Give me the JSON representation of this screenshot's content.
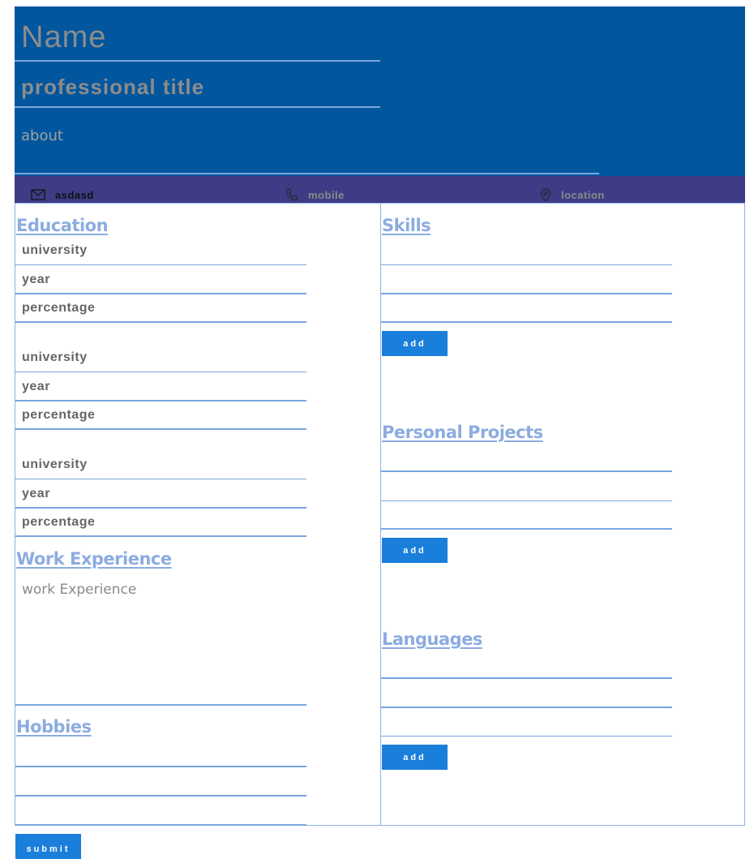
{
  "header": {
    "name_placeholder": "Name",
    "title_placeholder": "professional title",
    "about_placeholder": "about",
    "background": "#02569e"
  },
  "contact": {
    "email_value": "asdasd",
    "email_icon": "envelope-icon",
    "mobile_placeholder": "mobile",
    "mobile_icon": "phone-icon",
    "location_placeholder": "location",
    "location_icon": "map-pin-icon",
    "background": "#3d3c85"
  },
  "education": {
    "title": "Education",
    "entries": [
      {
        "university_placeholder": "university",
        "year_placeholder": "year",
        "percentage_placeholder": "percentage"
      },
      {
        "university_placeholder": "university",
        "year_placeholder": "year",
        "percentage_placeholder": "percentage"
      },
      {
        "university_placeholder": "university",
        "year_placeholder": "year",
        "percentage_placeholder": "percentage"
      }
    ]
  },
  "work": {
    "title": "Work Experience",
    "placeholder": "work Experience"
  },
  "hobbies": {
    "title": "Hobbies",
    "fields": [
      "",
      "",
      ""
    ]
  },
  "skills": {
    "title": "Skills",
    "fields": [
      "",
      "",
      ""
    ],
    "add_label": "add"
  },
  "projects": {
    "title": "Personal Projects",
    "fields": [
      "",
      "",
      ""
    ],
    "add_label": "add"
  },
  "languages": {
    "title": "Languages",
    "fields": [
      "",
      "",
      ""
    ],
    "add_label": "add"
  },
  "submit_label": "submit",
  "colors": {
    "accent": "#1a7fda",
    "section_title": "#8cace0",
    "underline": "#7aa6e0"
  }
}
